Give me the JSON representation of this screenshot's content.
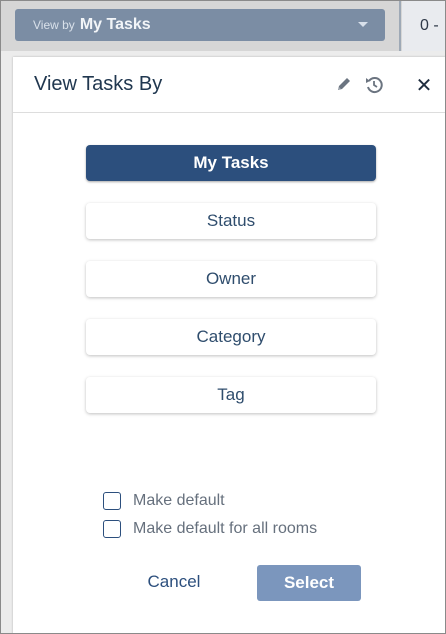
{
  "topbar": {
    "view_by_prefix": "View by",
    "view_by_value": "My Tasks",
    "right_chip_text": "0 -"
  },
  "panel": {
    "title": "View Tasks By",
    "options": [
      {
        "label": "My Tasks",
        "selected": true
      },
      {
        "label": "Status",
        "selected": false
      },
      {
        "label": "Owner",
        "selected": false
      },
      {
        "label": "Category",
        "selected": false
      },
      {
        "label": "Tag",
        "selected": false
      }
    ],
    "checkboxes": [
      {
        "label": "Make default",
        "checked": false
      },
      {
        "label": "Make default for all rooms",
        "checked": false
      }
    ],
    "cancel_label": "Cancel",
    "select_label": "Select"
  },
  "icons": {
    "edit": "pencil-icon",
    "restore": "history-icon",
    "close": "close-icon",
    "dropdown": "chevron-down-icon"
  },
  "colors": {
    "selected_option_bg": "#2c4f7d",
    "view_by_bg": "#7b8da4",
    "select_button_bg": "#7b96bd",
    "title_text": "#20374f"
  }
}
